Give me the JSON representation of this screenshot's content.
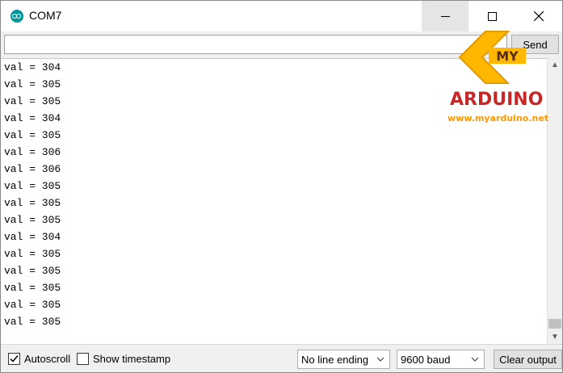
{
  "window": {
    "title": "COM7",
    "icon": "arduino-icon",
    "controls": [
      "minimize-icon",
      "maximize-icon",
      "close-icon"
    ]
  },
  "send_bar": {
    "input_value": "",
    "send_label": "Send"
  },
  "output": {
    "lines": [
      "val = 304",
      "val = 305",
      "val = 305",
      "val = 304",
      "val = 305",
      "val = 306",
      "val = 306",
      "val = 305",
      "val = 305",
      "val = 305",
      "val = 304",
      "val = 305",
      "val = 305",
      "val = 305",
      "val = 305",
      "val = 305"
    ]
  },
  "watermark": {
    "badge": "MY",
    "word": "ARDUINO",
    "url": "www.myarduino.net",
    "colors": {
      "orange": "#ffb700",
      "red": "#c62828",
      "url_orange": "#ff9800"
    }
  },
  "bottom_bar": {
    "autoscroll_label": "Autoscroll",
    "autoscroll_checked": true,
    "timestamp_label": "Show timestamp",
    "timestamp_checked": false,
    "line_ending_selected": "No line ending",
    "baud_selected": "9600 baud",
    "clear_label": "Clear output"
  }
}
